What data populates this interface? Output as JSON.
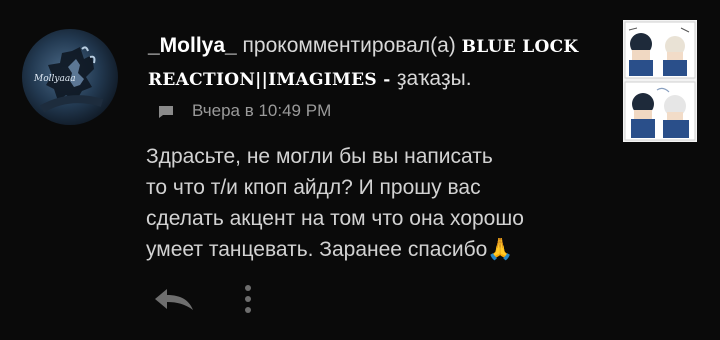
{
  "comment": {
    "username": "_Mollya_",
    "action_text": " прокомментировал(а) ",
    "post_title": "BLUE LOCK REACTION||IMAGIMES - ",
    "post_title_suffix": "ҙаҡаҙы",
    "post_title_end": ".",
    "timestamp": "Вчера в 10:49 PM",
    "body": "Здрасьте, не могли бы вы написать\nто что т/и кпоп айдл? И прошу вас\nсделать акцент на том что она хорошо\nумеет танцевать. Заранее спасибо🙏",
    "avatar_text": "Mollyaaa"
  },
  "icons": {
    "comment": "comment-icon",
    "reply": "reply-icon",
    "more": "more-vertical-icon"
  },
  "colors": {
    "background": "#0a0a0a",
    "muted": "#9a9a9a",
    "text": "#d2d2d2",
    "username": "#ffffff"
  }
}
